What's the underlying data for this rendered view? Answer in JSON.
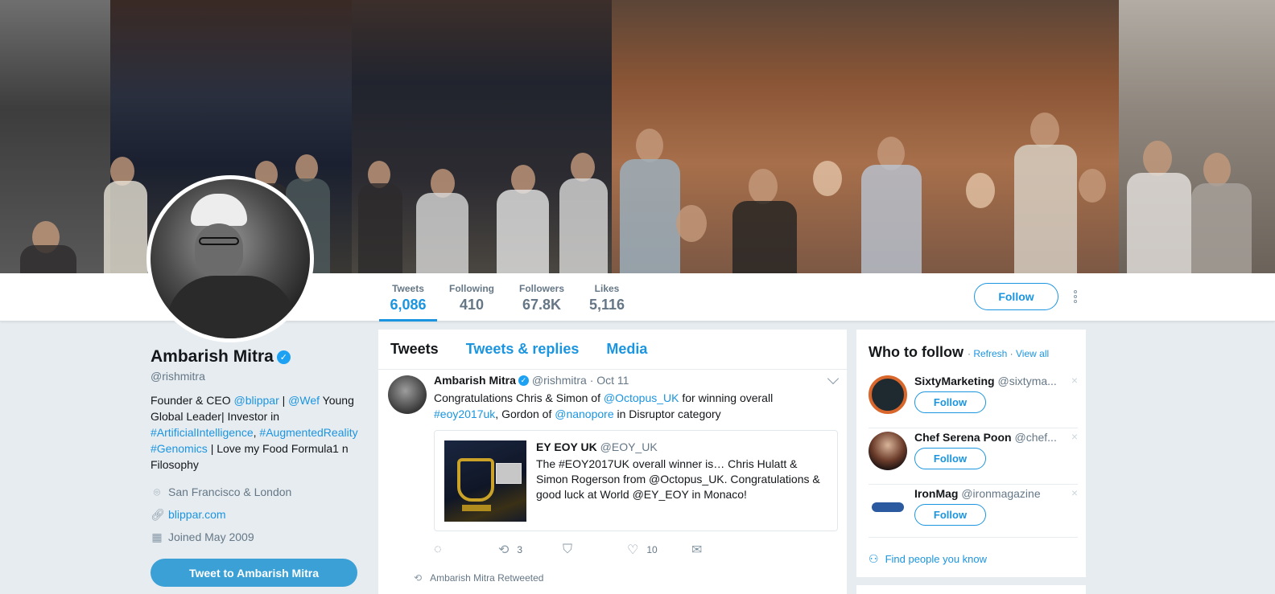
{
  "profile": {
    "name": "Ambarish Mitra",
    "handle": "@rishmitra",
    "bio_parts": {
      "p1": "Founder & CEO ",
      "blippar": "@blippar",
      "p2": " | ",
      "wef": "@Wef",
      "p3": " Young Global Leader| Investor in ",
      "ai": "#ArtificialIntelligence",
      "p4": ", ",
      "ar": "#AugmentedReality",
      "p5": " ",
      "genomics": "#Genomics",
      "p6": " | Love my Food Formula1 n Filosophy"
    },
    "location": "San Francisco & London",
    "website": "blippar.com",
    "joined": "Joined May 2009",
    "tweet_to_label": "Tweet to Ambarish Mitra"
  },
  "stats": [
    {
      "label": "Tweets",
      "value": "6,086"
    },
    {
      "label": "Following",
      "value": "410"
    },
    {
      "label": "Followers",
      "value": "67.8K"
    },
    {
      "label": "Likes",
      "value": "5,116"
    }
  ],
  "header_actions": {
    "follow_label": "Follow"
  },
  "timeline": {
    "tabs": [
      "Tweets",
      "Tweets & replies",
      "Media"
    ],
    "tweet": {
      "name": "Ambarish Mitra",
      "meta": "@rishmitra · Oct 11",
      "text": {
        "t1": "Congratulations Chris & Simon of ",
        "octopus": "@Octopus_UK",
        "t2": " for winning overall ",
        "eoy": "#eoy2017uk",
        "t3": ", Gordon of ",
        "nanopore": "@nanopore",
        "t4": " in Disruptor category"
      },
      "card": {
        "name": "EY EOY UK",
        "handle": "@EOY_UK",
        "text": "The #EOY2017UK overall winner is… Chris Hulatt & Simon Rogerson from @Octopus_UK. Congratulations & good luck at World @EY_EOY in Monaco!"
      },
      "retweets": "3",
      "likes": "10"
    },
    "retweeted_label": "Ambarish Mitra Retweeted"
  },
  "who_to_follow": {
    "title": "Who to follow",
    "refresh": "Refresh",
    "sep": " · ",
    "view_all": "View all",
    "follow_label": "Follow",
    "close": "×",
    "suggestions": [
      {
        "name": "SixtyMarketing",
        "handle": "@sixtyma..."
      },
      {
        "name": "Chef Serena Poon",
        "handle": "@chef..."
      },
      {
        "name": "IronMag",
        "handle": "@ironmagazine"
      }
    ],
    "find_people": "Find people you know"
  },
  "colors": {
    "accent": "#1b95e0",
    "tweet_to_bg": "#3ba0d6",
    "page_bg": "#e6ecf0"
  },
  "icons": [
    "verified-badge-icon",
    "location-pin-icon",
    "link-icon",
    "calendar-icon",
    "reply-icon",
    "retweet-icon",
    "pocket-icon",
    "heart-icon",
    "mail-icon",
    "people-icon",
    "more-dots-icon",
    "chevron-down-icon",
    "close-icon"
  ]
}
